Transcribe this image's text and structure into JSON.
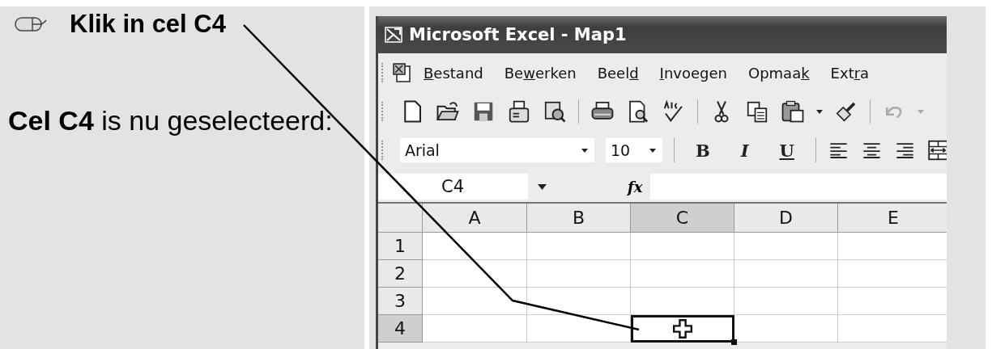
{
  "instructions": {
    "step": "Klik in cel C4",
    "result": "**Cel C4** is nu geselecteerd:"
  },
  "window": {
    "title": "Microsoft Excel - Map1"
  },
  "menu": [
    {
      "key": "B",
      "after": "estand"
    },
    {
      "before": "Be",
      "key": "w",
      "after": "erken"
    },
    {
      "before": "Beel",
      "key": "d"
    },
    {
      "key": "I",
      "after": "nvoegen"
    },
    {
      "before": "Opmaa",
      "key": "k"
    },
    {
      "before": "Ext",
      "key": "r",
      "after": "a"
    }
  ],
  "standard_toolbar": {
    "undo_disabled": true
  },
  "format_toolbar": {
    "font": "Arial",
    "size": "10",
    "styles": [
      {
        "label": "B",
        "kind": "bold"
      },
      {
        "label": "I",
        "kind": "italic"
      },
      {
        "label": "U",
        "kind": "underline"
      }
    ]
  },
  "formula_bar": {
    "name_box": "C4",
    "fx": "fx"
  },
  "sheet": {
    "columns": [
      {
        "label": "A",
        "selected": false
      },
      {
        "label": "B",
        "selected": false
      },
      {
        "label": "C",
        "selected": true
      },
      {
        "label": "D",
        "selected": false
      },
      {
        "label": "E",
        "selected": false
      }
    ],
    "rows": [
      {
        "label": "1",
        "selected": false
      },
      {
        "label": "2",
        "selected": false
      },
      {
        "label": "3",
        "selected": false
      },
      {
        "label": "4",
        "selected": true
      }
    ]
  }
}
